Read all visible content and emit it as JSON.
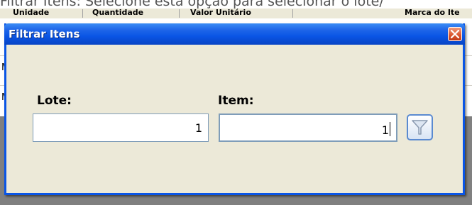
{
  "caption": "Filtrar Itens: Selecione esta opção para selecionar o lote/",
  "grid": {
    "columns": [
      "Unidade",
      "Quantidade",
      "Valor Unitário",
      "Marca do Ite"
    ],
    "row_markers": [
      "M",
      "M"
    ]
  },
  "dialog": {
    "title": "Filtrar Itens",
    "close_icon": "close-icon",
    "lote": {
      "label": "Lote:",
      "value": "1"
    },
    "item": {
      "label": "Item:",
      "value": "1"
    },
    "filter_icon": "funnel-icon"
  },
  "colors": {
    "titlebar": "#0a55e5",
    "dialog_bg": "#ece9d8",
    "close_button": "#d9532c",
    "filter_border": "#5a8ad0"
  }
}
